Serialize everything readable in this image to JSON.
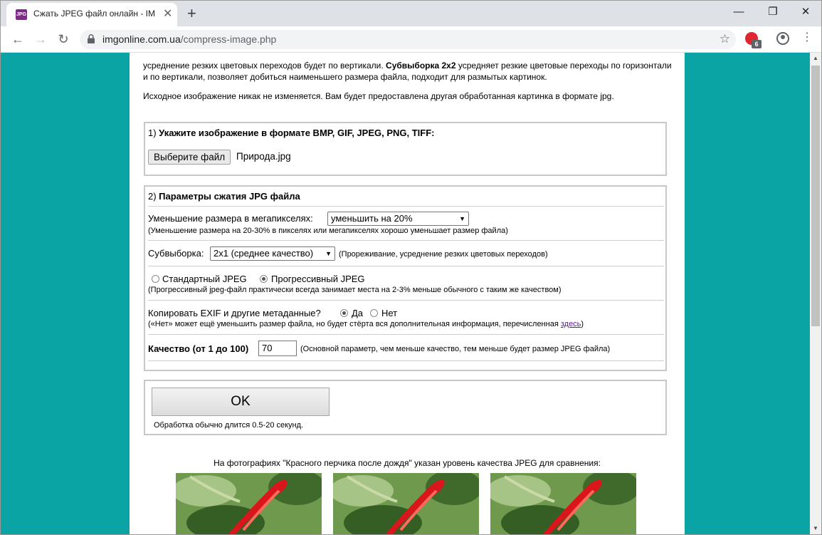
{
  "browser": {
    "tab_title": "Сжать JPEG файл онлайн - IMG",
    "favicon_text": "JPG",
    "url_domain": "imgonline.com.ua",
    "url_path": "/compress-image.php",
    "extension_badge": "6"
  },
  "page": {
    "intro_text_1": "усреднение резких цветовых переходов будет по вертикали. ",
    "intro_bold": "Субвыборка 2x2",
    "intro_text_2": " усредняет резкие цветовые переходы по горизонтали и по вертикали, позволяет добиться наименьшего размера файла, подходит для размытых картинок.",
    "intro_para2": "Исходное изображение никак не изменяется. Вам будет предоставлена другая обработанная картинка в формате jpg.",
    "section1": {
      "num": "1) ",
      "title": "Укажите изображение в формате BMP, GIF, JPEG, PNG, TIFF:",
      "file_button": "Выберите файл",
      "file_name": "Природа.jpg"
    },
    "section2": {
      "num": "2) ",
      "title": "Параметры сжатия JPG файла",
      "resize_label": "Уменьшение размера в мегапикселях:",
      "resize_value": "уменьшить на 20%",
      "resize_note": "(Уменьшение размера на 20-30% в пикселях или мегапикселях хорошо уменьшает размер файла)",
      "subsampling_label": "Субвыборка:",
      "subsampling_value": "2x1 (среднее качество)",
      "subsampling_note": "(Прореживание, усреднение резких цветовых переходов)",
      "std_jpeg": "Стандартный JPEG",
      "prog_jpeg": "Прогрессивный JPEG",
      "jpeg_mode_selected": "progressive",
      "jpeg_note": "(Прогрессивный jpeg-файл практически всегда занимает места на 2-3% меньше обычного с таким же качеством)",
      "exif_label": "Копировать EXIF и другие метаданные?",
      "exif_yes": "Да",
      "exif_no": "Нет",
      "exif_selected": "yes",
      "exif_note": "(«Нет» может ещё уменьшить размер файла, но будет стёрта вся дополнительная информация, перечисленная ",
      "exif_link": "здесь",
      "exif_note_end": ")",
      "quality_label": "Качество (от 1 до 100)",
      "quality_value": "70",
      "quality_note": "(Основной параметр, чем меньше качество, тем меньше будет размер JPEG файла)"
    },
    "section3": {
      "ok_button": "OK",
      "ok_note": "Обработка обычно длится 0.5-20 секунд."
    },
    "photos_caption": "На фотографиях \"Красного перчика после дождя\" указан уровень качества JPEG для сравнения:"
  },
  "colors": {
    "page_background": "#0aa4a4",
    "link": "#551a8b",
    "pepper_red": "#d8161c",
    "leaf_green": "#4f7a3c"
  }
}
